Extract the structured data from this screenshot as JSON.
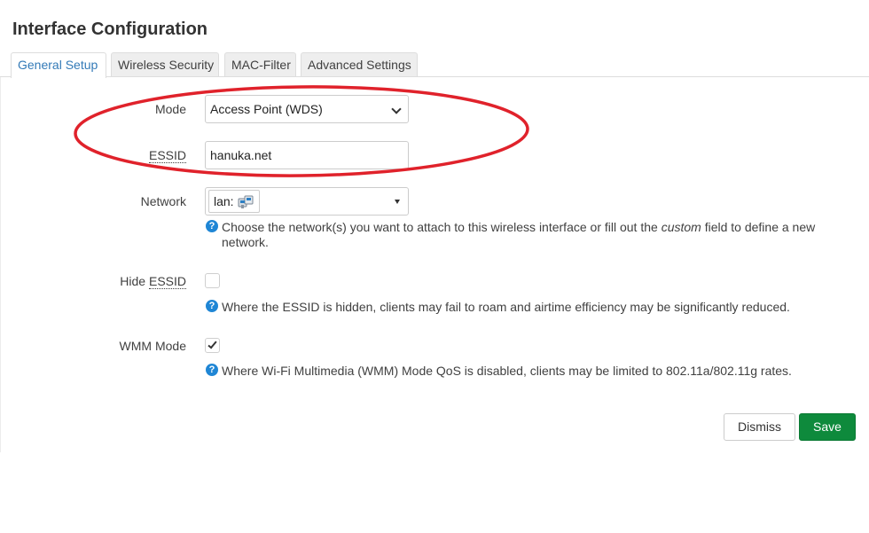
{
  "page": {
    "title": "Interface Configuration"
  },
  "tabs": [
    {
      "label": "General Setup",
      "active": true
    },
    {
      "label": "Wireless Security",
      "active": false
    },
    {
      "label": "MAC-Filter",
      "active": false
    },
    {
      "label": "Advanced Settings",
      "active": false
    }
  ],
  "form": {
    "mode": {
      "label": "Mode",
      "value": "Access Point (WDS)"
    },
    "essid": {
      "label": "ESSID",
      "value": "hanuka.net"
    },
    "network": {
      "label": "Network",
      "value": "lan:",
      "icon": "network-interface-icon",
      "help_before": "Choose the network(s) you want to attach to this wireless interface or fill out the ",
      "help_em": "custom",
      "help_after": " field to define a new network."
    },
    "hide_essid": {
      "label": "Hide ESSID",
      "label_abbr": "ESSID",
      "label_prefix": "Hide ",
      "checked": false,
      "help": "Where the ESSID is hidden, clients may fail to roam and airtime efficiency may be significantly reduced."
    },
    "wmm_mode": {
      "label": "WMM Mode",
      "checked": true,
      "help": "Where Wi-Fi Multimedia (WMM) Mode QoS is disabled, clients may be limited to 802.11a/802.11g rates."
    }
  },
  "help_icon_glyph": "?",
  "buttons": {
    "dismiss": "Dismiss",
    "save": "Save"
  },
  "colors": {
    "accent_link": "#337ab7",
    "save_green": "#0e8a3c",
    "help_icon_blue": "#1f86d5",
    "annotation_red": "#e0222b"
  }
}
